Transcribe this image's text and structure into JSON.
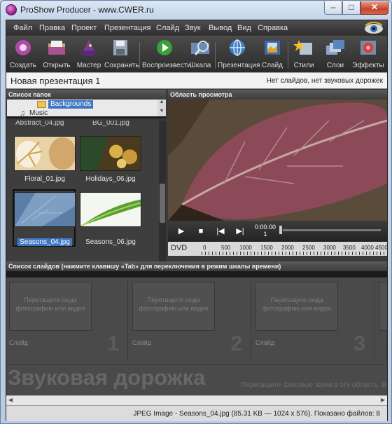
{
  "window": {
    "title": "ProShow Producer - www.CWER.ru"
  },
  "menu": [
    "Файл",
    "Правка",
    "Проект",
    "Презентация",
    "Слайд",
    "Звук",
    "Вывод",
    "Вид",
    "Справка"
  ],
  "toolbar": {
    "create": "Создать",
    "open": "Открыть",
    "wizard": "Мастер",
    "save": "Сохранить",
    "play": "Воспроизвести",
    "scale": "Шкала",
    "presentation": "Презентация",
    "slide": "Слайд",
    "styles": "Стили",
    "layers": "Слои",
    "effects": "Эффекты"
  },
  "project": {
    "title": "Новая презентация 1",
    "status": "Нет слайдов, нет звуковых дорожек"
  },
  "folders": {
    "header": "Список папок",
    "selected": "Backgrounds",
    "items": [
      "Music"
    ]
  },
  "files": {
    "partial_top": [
      "Abstract_04.jpg",
      "BG_001.jpg"
    ],
    "items": [
      {
        "name": "Floral_01.jpg"
      },
      {
        "name": "Holidays_06.jpg"
      },
      {
        "name": "Seasons_04.jpg",
        "selected": true
      },
      {
        "name": "Seasons_06.jpg"
      }
    ]
  },
  "preview": {
    "header": "Область просмотра",
    "time": "0:00.00",
    "slide_index": "1",
    "output": "DVD",
    "ruler": [
      "0",
      "500",
      "1000",
      "1500",
      "2000",
      "2500",
      "3000",
      "3500",
      "4000",
      "4500"
    ]
  },
  "slides": {
    "header": "Список слайдов (нажмите клавишу «Tab» для переключения в режим шкалы времени)",
    "drop_hint": "Перетащите сюда фотографию или видео",
    "slide_label": "Слайд",
    "numbers": [
      "1",
      "2",
      "3"
    ]
  },
  "audio": {
    "title": "Звуковая дорожка",
    "hint": "Перетащите фоновые звуки в эту область. В"
  },
  "status": {
    "text": "JPEG Image - Seasons_04.jpg  (85.31 KB — 1024 x 576). Показано файлов: 8"
  }
}
